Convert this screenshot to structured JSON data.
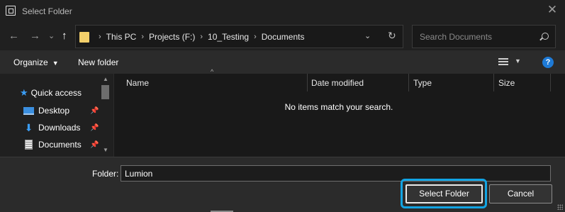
{
  "window": {
    "title": "Select Folder",
    "close_glyph": "✕"
  },
  "nav": {
    "back_glyph": "←",
    "forward_glyph": "→",
    "recent_glyph": "⌄",
    "up_glyph": "↑",
    "breadcrumbs": [
      "This PC",
      "Projects (F:)",
      "10_Testing",
      "Documents"
    ],
    "address_dropdown_glyph": "⌄",
    "refresh_glyph": "↻",
    "search_placeholder": "Search Documents"
  },
  "toolbar": {
    "organize_label": "Organize",
    "organize_caret": "▼",
    "new_folder_label": "New folder",
    "view_caret": "▼",
    "help_glyph": "?"
  },
  "sidebar": {
    "quick_access": "Quick access",
    "items": [
      {
        "label": "Desktop",
        "icon": "desktop-icon",
        "pinned": true
      },
      {
        "label": "Downloads",
        "icon": "downloads-icon",
        "pinned": true
      },
      {
        "label": "Documents",
        "icon": "documents-icon",
        "pinned": true
      }
    ],
    "pin_glyph": "📌"
  },
  "file_list": {
    "columns": [
      "Name",
      "Date modified",
      "Type",
      "Size"
    ],
    "sort_glyph": "^",
    "empty_message": "No items match your search."
  },
  "footer": {
    "folder_label": "Folder:",
    "folder_value": "Lumion",
    "select_button": "Select Folder",
    "cancel_button": "Cancel"
  },
  "colors": {
    "accent": "#12a4e3",
    "help_blue": "#1e7ad6",
    "folder_yellow": "#f3cf6a"
  }
}
